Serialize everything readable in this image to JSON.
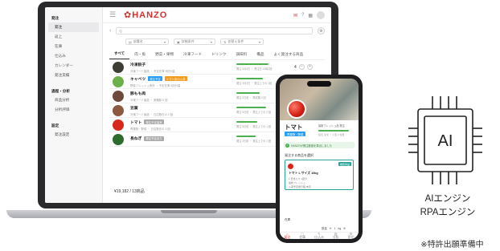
{
  "app": {
    "logo_text": "HANZO",
    "brand_color": "#d82e2e",
    "search_placeholder": "Q",
    "filters": [
      "部署名",
      "詳細条件",
      "並替え条件"
    ]
  },
  "sidebar": {
    "sections": [
      {
        "title": "発注",
        "items": [
          "発注",
          "返上",
          "在庫",
          "仕込み",
          "カレンダー",
          "発注実績"
        ]
      },
      {
        "title": "過程・分析",
        "items": [
          "商品分析",
          "分析評価"
        ]
      },
      {
        "title": "設定",
        "items": [
          "発注設定"
        ]
      }
    ],
    "active_item": "発注"
  },
  "tabs": [
    "すべて",
    "肉・魚",
    "野菜・果物",
    "冷凍フード",
    "ドリンク",
    "調味料",
    "備品",
    "よく発注する商品"
  ],
  "active_tab": "すべて",
  "rows": [
    {
      "name": "冷凍餃子",
      "sub": "冷凍フード製品 ・ 予定在庫 3回分量",
      "badges": [],
      "bar_fraction": 0.9,
      "bar_text": "発注 4月3日 ・ 発注日 14時1回",
      "qty": "4",
      "thumb_color": "#3d3d35"
    },
    {
      "name": "キャベツ",
      "sub": "野菜フレッシュ食材 ・ 予定在庫 5回分量",
      "badges": [
        {
          "text": "発注予定",
          "color": "#2a9df4"
        },
        {
          "text": "トマト系の入荷",
          "color": "#f09c1e"
        }
      ],
      "bar_fraction": 0.75,
      "bar_text": "発注 3月3日 ・ 発注上での 1回",
      "qty": "",
      "thumb_color": "#6bb04a"
    },
    {
      "name": "豚もも肉",
      "sub": "冷凍フード製品 ・ 実棚卸 5 回",
      "badges": [],
      "bar_fraction": 0.65,
      "bar_text": "発注 2日前 ・ 再試験 2 回",
      "qty": "",
      "thumb_color": "#6c4a3c"
    },
    {
      "name": "豆腐",
      "sub": "冷凍フード製品 ・ 日店数在の 2 回",
      "badges": [],
      "bar_fraction": 0.85,
      "bar_text": "発注 3日前 ・ 発注上での 2 回",
      "qty": "",
      "thumb_color": "#8c5a40"
    },
    {
      "name": "トマト",
      "sub": "青果物・野菜 ・ 日店数在の 3 回",
      "badges": [
        {
          "text": "発注予定量有",
          "color": "#aaaaaa"
        }
      ],
      "bar_fraction": 0.6,
      "bar_text": "発注 5日前 ・ 発注上での 1 回",
      "qty": "",
      "thumb_color": "#d8261a"
    },
    {
      "name": "長ねぎ",
      "sub": "",
      "badges": [
        {
          "text": "発注予定あり",
          "color": "#aaaaaa"
        }
      ],
      "bar_fraction": 0.55,
      "bar_text": "発注 2日前 ・ 発注上での 1 回",
      "qty": "",
      "thumb_color": "#2e6b2e"
    }
  ],
  "total": "¥19,182 / 13商品",
  "phone": {
    "product_name": "トマト",
    "badge": "青果物・野菜",
    "side_title": "最新フレッシュ品 発注",
    "side_sub": "最近 注文 ・ 1 回 2 在庫",
    "status": "HANZOが発注推奨を算出しました",
    "select_heading": "発注する商品を選択",
    "card": {
      "badge": "推奨商品",
      "title": "トマト L サイズ 10kg",
      "lines": [
        "1 日当たり 1回分",
        "最新フレッシュ",
        "入荷予定量日程 未定"
      ]
    },
    "inquiry": "在庫",
    "qty_label": "数量",
    "qty_value": "1",
    "unit": "kg",
    "nav": [
      "発注",
      "在庫",
      "仕込み",
      "分析",
      "設定"
    ]
  },
  "ai_chip": {
    "label": "AI",
    "caption_line1": "AIエンジン",
    "caption_line2": "RPAエンジン",
    "patent": "※特許出願準備中"
  }
}
